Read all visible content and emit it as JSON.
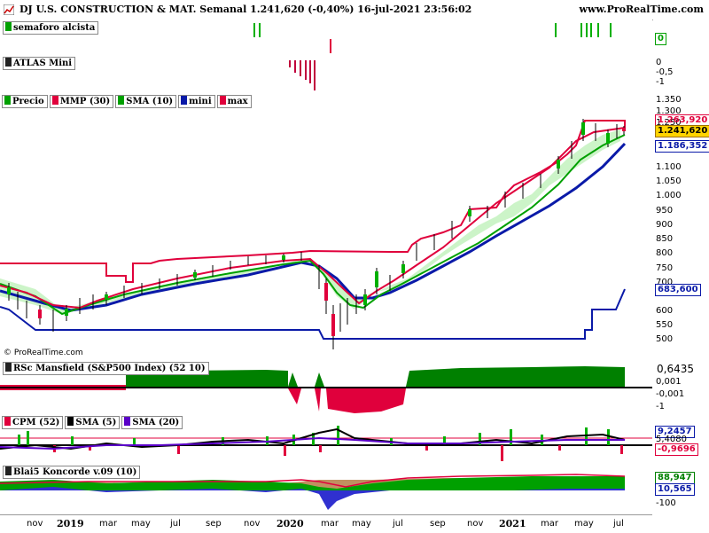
{
  "header": {
    "title": "DJ U.S. CONSTRUCTION & MAT. Semanal 1.241,620 (-0,40%) 16-jul-2021 23:56:02",
    "website": "www.ProRealTime.com"
  },
  "panels": {
    "semaforo": {
      "label": "semaforo alcista",
      "value": "0"
    },
    "atlas": {
      "label": "ATLAS Mini",
      "ticks": [
        "0",
        "-0,5",
        "-1"
      ]
    },
    "price": {
      "legend": [
        "Precio",
        "MMP (30)",
        "SMA (10)",
        "mini",
        "max"
      ],
      "ticks": [
        "1.350",
        "1.300",
        "1.250",
        "1.150",
        "1.100",
        "1.050",
        "1.000",
        "950",
        "900",
        "850",
        "800",
        "750",
        "700",
        "650",
        "600",
        "550",
        "500"
      ],
      "values": {
        "max": "1.263,920",
        "last": "1.241,620",
        "sma": "1.186,352",
        "mini": "683,600"
      },
      "copyright": "© ProRealTime.com"
    },
    "rsc": {
      "label": "RSc Mansfield (S&P500 Index) (52 10)",
      "value": "0,6435",
      "ticks": [
        "0,001",
        "-0,001",
        "-1"
      ]
    },
    "cpm": {
      "legend": [
        "CPM (52)",
        "SMA (5)",
        "SMA (20)"
      ],
      "values": [
        "9,2457",
        "5,4080",
        "-0,9696"
      ]
    },
    "blai5": {
      "label": "Blai5 Koncorde v.09 (10)",
      "values": [
        "88,947",
        "10,565"
      ],
      "ticks": [
        "-100"
      ]
    }
  },
  "xaxis": {
    "labels": [
      "nov",
      "2019",
      "mar",
      "may",
      "jul",
      "sep",
      "nov",
      "2020",
      "mar",
      "may",
      "jul",
      "sep",
      "nov",
      "2021",
      "mar",
      "may",
      "jul"
    ],
    "bold": [
      "2019",
      "2020",
      "2021"
    ]
  },
  "colors": {
    "green": "#00a000",
    "red": "#e0003c",
    "blue": "#0a1aa8",
    "darkgreen": "#008000"
  }
}
